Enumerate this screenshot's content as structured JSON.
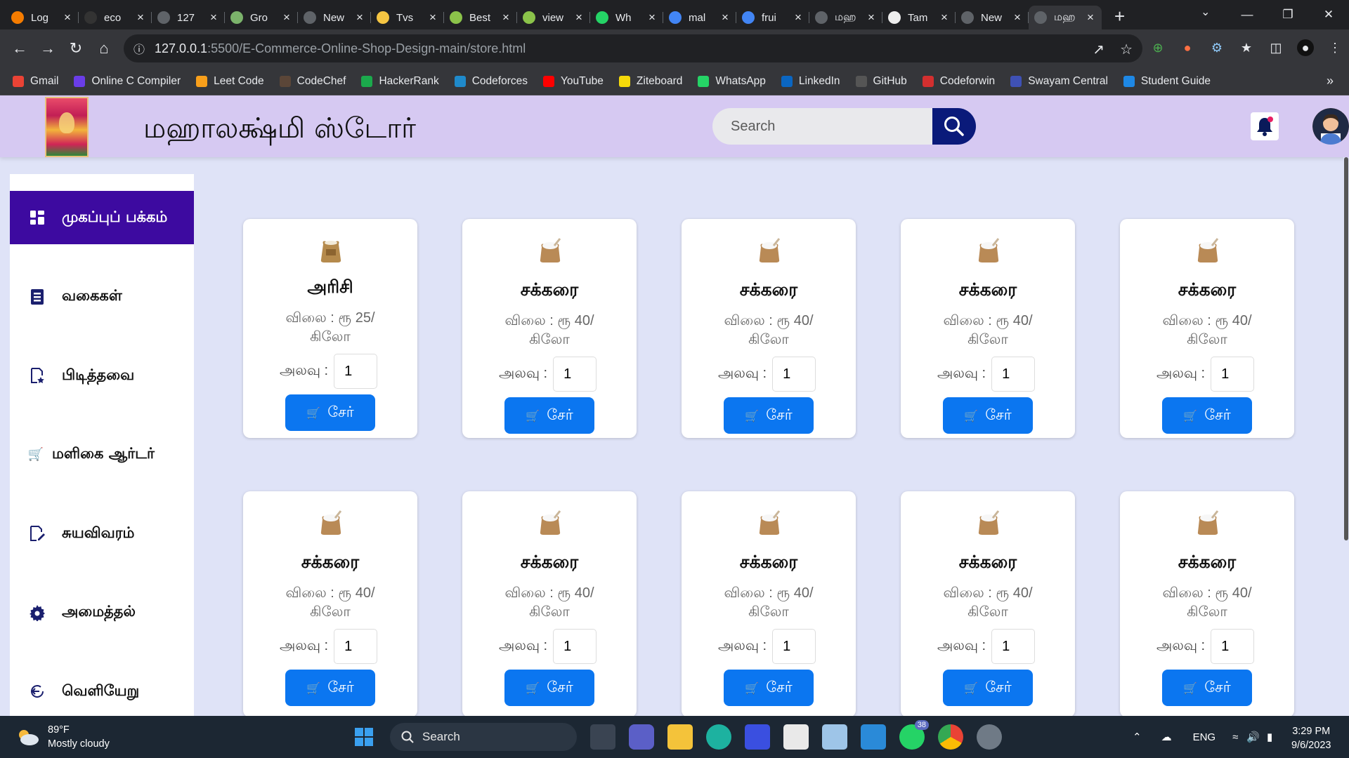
{
  "browser": {
    "tabs": [
      {
        "title": "Log",
        "fav": "#f57c00"
      },
      {
        "title": "eco",
        "fav": "#333"
      },
      {
        "title": "127",
        "fav": "#5f6368"
      },
      {
        "title": "Gro",
        "fav": "#7bb36b"
      },
      {
        "title": "New",
        "fav": "#5f6368"
      },
      {
        "title": "Tvs",
        "fav": "#f5c542"
      },
      {
        "title": "Best",
        "fav": "#8bc34a"
      },
      {
        "title": "view",
        "fav": "#8bc34a"
      },
      {
        "title": "Wh",
        "fav": "#25d366"
      },
      {
        "title": "mal",
        "fav": "#4285f4"
      },
      {
        "title": "frui",
        "fav": "#4285f4"
      },
      {
        "title": "மஹ",
        "fav": "#5f6368"
      },
      {
        "title": "Tam",
        "fav": "#eeeeee"
      },
      {
        "title": "New",
        "fav": "#5f6368"
      },
      {
        "title": "மஹ",
        "fav": "#5f6368",
        "active": true
      }
    ],
    "new_tab": "+",
    "url_host": "127.0.0.1",
    "url_path": ":5500/E-Commerce-Online-Shop-Design-main/store.html",
    "bookmarks": [
      {
        "label": "Gmail",
        "color": "#ea4335"
      },
      {
        "label": "Online C Compiler",
        "color": "#6a3de8"
      },
      {
        "label": "Leet Code",
        "color": "#f89f1b"
      },
      {
        "label": "CodeChef",
        "color": "#5b4638"
      },
      {
        "label": "HackerRank",
        "color": "#1ba94c"
      },
      {
        "label": "Codeforces",
        "color": "#1f8acb"
      },
      {
        "label": "YouTube",
        "color": "#ff0000"
      },
      {
        "label": "Ziteboard",
        "color": "#f5d90a"
      },
      {
        "label": "WhatsApp",
        "color": "#25d366"
      },
      {
        "label": "LinkedIn",
        "color": "#0a66c2"
      },
      {
        "label": "GitHub",
        "color": "#555"
      },
      {
        "label": "Codeforwin",
        "color": "#d32f2f"
      },
      {
        "label": "Swayam Central",
        "color": "#3f51b5"
      },
      {
        "label": "Student Guide",
        "color": "#1e88e5"
      }
    ],
    "bookmarks_more": "»"
  },
  "header": {
    "title": "மஹாலக்ஷ்மி ஸ்டோர்",
    "search_placeholder": "Search"
  },
  "sidebar": {
    "items": [
      {
        "label": "முகப்புப் பக்கம்",
        "icon": "dashboard-icon",
        "active": true
      },
      {
        "label": "வகைகள்",
        "icon": "list-icon"
      },
      {
        "label": "பிடித்தவை",
        "icon": "favorites-icon"
      },
      {
        "label": "மளிகை ஆர்டர்",
        "icon": "cart-icon"
      },
      {
        "label": "சுயவிவரம்",
        "icon": "edit-profile-icon"
      },
      {
        "label": "அமைத்தல்",
        "icon": "gear-icon"
      },
      {
        "label": "வெளியேறு",
        "icon": "logout-icon"
      }
    ]
  },
  "products": [
    {
      "name": "அரிசி",
      "price": "விலை : ரூ 25/ கிலோ",
      "qty_label": "அலவு :",
      "qty": "1",
      "add_label": "சேர்",
      "icon": "rice-sack-icon"
    },
    {
      "name": "சக்கரை",
      "price": "விலை : ரூ 40/ கிலோ",
      "qty_label": "அலவு :",
      "qty": "1",
      "add_label": "சேர்",
      "icon": "sugar-sack-icon"
    },
    {
      "name": "சக்கரை",
      "price": "விலை : ரூ 40/ கிலோ",
      "qty_label": "அலவு :",
      "qty": "1",
      "add_label": "சேர்",
      "icon": "sugar-sack-icon"
    },
    {
      "name": "சக்கரை",
      "price": "விலை : ரூ 40/ கிலோ",
      "qty_label": "அலவு :",
      "qty": "1",
      "add_label": "சேர்",
      "icon": "sugar-sack-icon"
    },
    {
      "name": "சக்கரை",
      "price": "விலை : ரூ 40/ கிலோ",
      "qty_label": "அலவு :",
      "qty": "1",
      "add_label": "சேர்",
      "icon": "sugar-sack-icon"
    },
    {
      "name": "சக்கரை",
      "price": "விலை : ரூ 40/ கிலோ",
      "qty_label": "அலவு :",
      "qty": "1",
      "add_label": "சேர்",
      "icon": "sugar-sack-icon"
    },
    {
      "name": "சக்கரை",
      "price": "விலை : ரூ 40/ கிலோ",
      "qty_label": "அலவு :",
      "qty": "1",
      "add_label": "சேர்",
      "icon": "sugar-sack-icon"
    },
    {
      "name": "சக்கரை",
      "price": "விலை : ரூ 40/ கிலோ",
      "qty_label": "அலவு :",
      "qty": "1",
      "add_label": "சேர்",
      "icon": "sugar-sack-icon"
    },
    {
      "name": "சக்கரை",
      "price": "விலை : ரூ 40/ கிலோ",
      "qty_label": "அலவு :",
      "qty": "1",
      "add_label": "சேர்",
      "icon": "sugar-sack-icon"
    },
    {
      "name": "சக்கரை",
      "price": "விலை : ரூ 40/ கிலோ",
      "qty_label": "அலவு :",
      "qty": "1",
      "add_label": "சேர்",
      "icon": "sugar-sack-icon"
    }
  ],
  "taskbar": {
    "weather_temp": "89°F",
    "weather_desc": "Mostly cloudy",
    "search_label": "Search",
    "whatsapp_badge": "38",
    "lang": "ENG",
    "time": "3:29 PM",
    "date": "9/6/2023"
  }
}
